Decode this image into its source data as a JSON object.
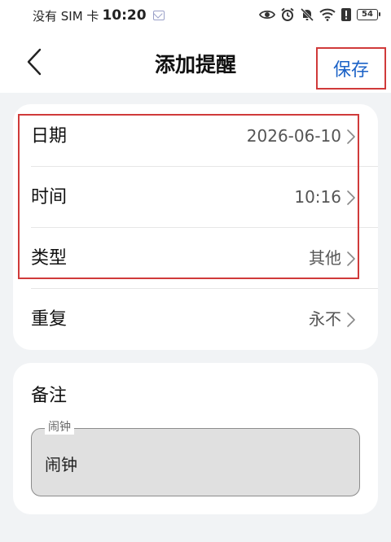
{
  "status_bar": {
    "carrier": "没有 SIM 卡",
    "time": "10:20",
    "battery": "54"
  },
  "header": {
    "title": "添加提醒",
    "save_label": "保存"
  },
  "settings": {
    "date": {
      "label": "日期",
      "value": "2026-06-10"
    },
    "time": {
      "label": "时间",
      "value": "10:16"
    },
    "type": {
      "label": "类型",
      "value": "其他"
    },
    "repeat": {
      "label": "重复",
      "value": "永不"
    }
  },
  "note": {
    "title": "备注",
    "field_label": "闹钟",
    "value": "闹钟"
  },
  "colors": {
    "accent": "#1b62c7",
    "highlight": "#d03a3a",
    "background": "#f1f3f5"
  }
}
